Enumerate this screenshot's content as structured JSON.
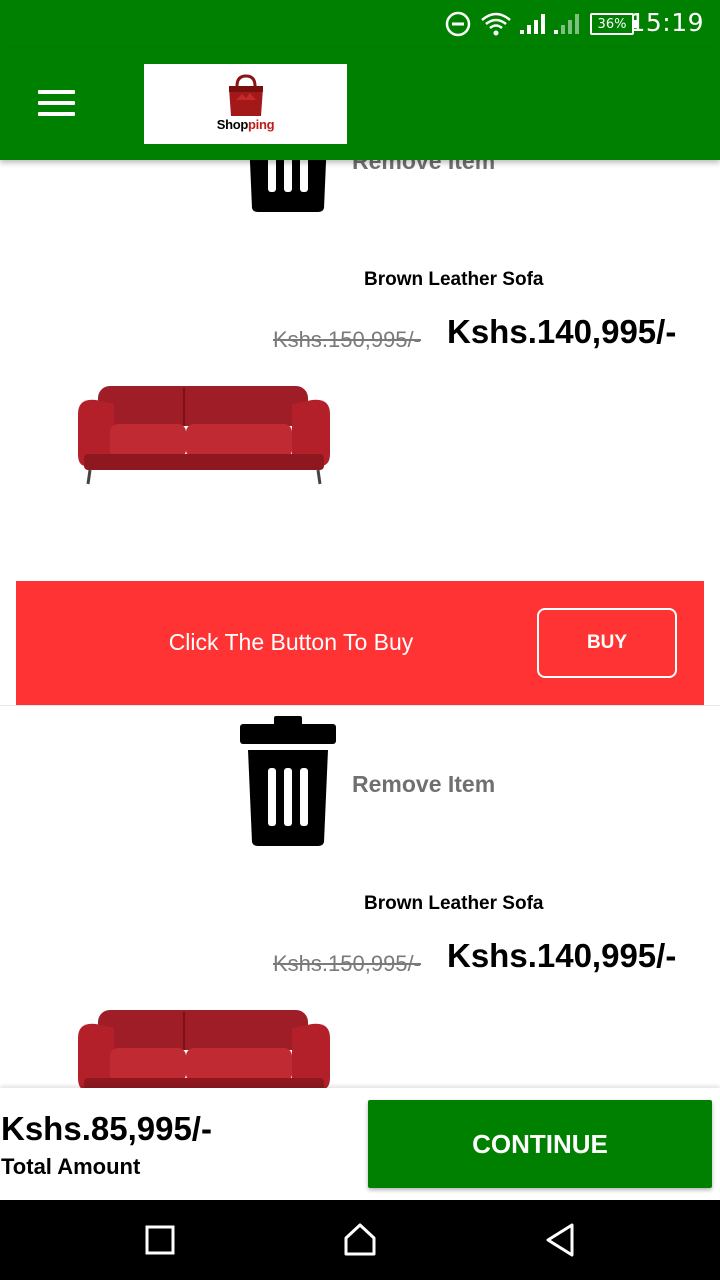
{
  "status_bar": {
    "time": "15:19",
    "battery": "36%",
    "icons": [
      "do-not-disturb-icon",
      "wifi-icon",
      "signal-icon",
      "signal-weak-icon",
      "battery-icon"
    ]
  },
  "app_bar": {
    "menu_icon": "hamburger-menu-icon",
    "logo": {
      "text_main": "Shop",
      "text_accent": "ping",
      "icon": "shopping-bag-icon"
    }
  },
  "cart": {
    "items": [
      {
        "remove_label": "Remove Item",
        "name": "Brown Leather Sofa",
        "old_price": "Kshs.150,995/-",
        "price": "Kshs.140,995/-",
        "image_icon": "red-sofa-image"
      },
      {
        "remove_label": "Remove Item",
        "name": "Brown Leather Sofa",
        "old_price": "Kshs.150,995/-",
        "price": "Kshs.140,995/-",
        "image_icon": "red-sofa-image"
      }
    ],
    "buy_prompt": "Click The Button To Buy",
    "buy_label": "BUY"
  },
  "summary": {
    "total_amount": "Kshs.85,995/-",
    "total_label": "Total Amount",
    "continue_label": "CONTINUE"
  },
  "nav_bar": {
    "buttons": [
      "recents-square-icon",
      "home-icon",
      "back-triangle-icon"
    ]
  },
  "colors": {
    "primary": "#008000",
    "buy_banner": "#ff3333",
    "sofa": "#b3202a"
  }
}
